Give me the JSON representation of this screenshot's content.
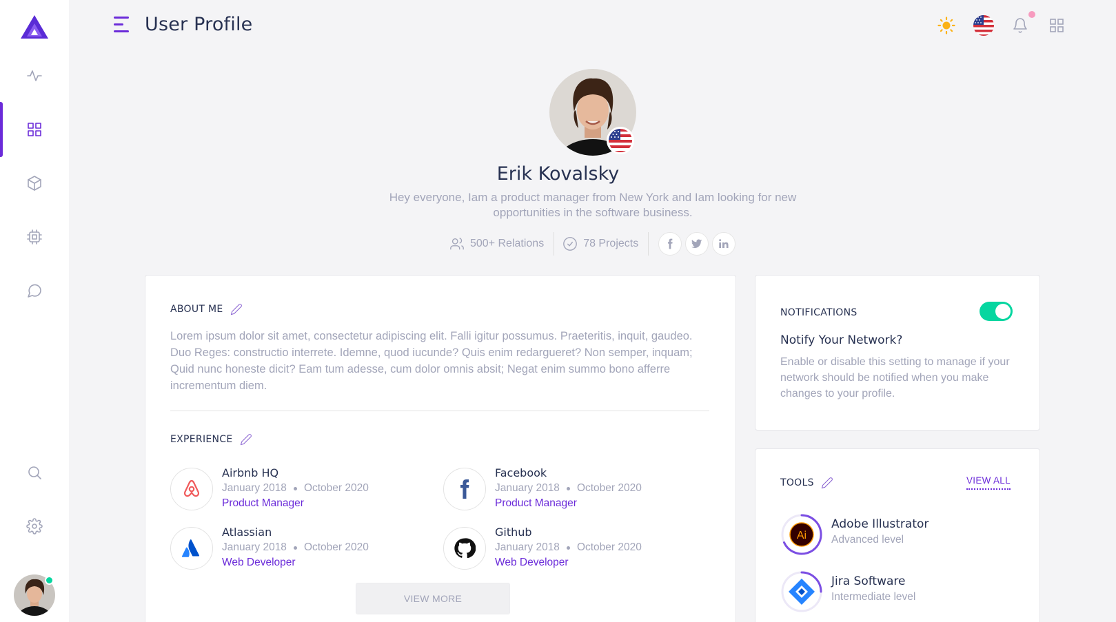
{
  "header": {
    "title": "User Profile"
  },
  "sidebar": {
    "items": [
      {
        "icon": "activity-icon"
      },
      {
        "icon": "grid-icon",
        "active": true
      },
      {
        "icon": "cube-icon"
      },
      {
        "icon": "cpu-icon"
      },
      {
        "icon": "message-icon"
      },
      {
        "icon": "search-icon"
      },
      {
        "icon": "settings-icon"
      }
    ]
  },
  "profile": {
    "name": "Erik Kovalsky",
    "bio": "Hey everyone, Iam a product manager from New York and Iam looking for new opportunities in the software business.",
    "relations": "500+ Relations",
    "projects": "78 Projects",
    "socials": [
      "facebook-icon",
      "twitter-icon",
      "linkedin-icon"
    ]
  },
  "about": {
    "title": "ABOUT ME",
    "text": "Lorem ipsum dolor sit amet, consectetur adipiscing elit. Falli igitur possumus. Praeteritis, inquit, gaudeo. Duo Reges: constructio interrete. Idemne, quod iucunde? Quis enim redargueret? Non semper, inquam; Quid nunc honeste dicit? Eam tum adesse, cum dolor omnis absit; Negat enim summo bono afferre incrementum diem."
  },
  "experience": {
    "title": "EXPERIENCE",
    "items": [
      {
        "company": "Airbnb HQ",
        "start": "January 2018",
        "end": "October 2020",
        "role": "Product Manager",
        "logo": "airbnb-icon"
      },
      {
        "company": "Facebook",
        "start": "January 2018",
        "end": "October 2020",
        "role": "Product Manager",
        "logo": "facebook-icon"
      },
      {
        "company": "Atlassian",
        "start": "January 2018",
        "end": "October 2020",
        "role": "Web Developer",
        "logo": "atlassian-icon"
      },
      {
        "company": "Github",
        "start": "January 2018",
        "end": "October 2020",
        "role": "Web Developer",
        "logo": "github-icon"
      }
    ],
    "view_more": "VIEW MORE"
  },
  "notifications": {
    "title": "NOTIFICATIONS",
    "enabled": true,
    "subtitle": "Notify Your Network?",
    "text": "Enable or disable this setting to manage if your network should be notified when you make changes to your profile."
  },
  "tools": {
    "title": "TOOLS",
    "view_all": "VIEW ALL",
    "items": [
      {
        "name": "Adobe Illustrator",
        "level": "Advanced level",
        "icon": "illustrator-icon"
      },
      {
        "name": "Jira Software",
        "level": "Intermediate level",
        "icon": "jira-icon"
      }
    ]
  },
  "colors": {
    "accent": "#6b2bd9",
    "success": "#06d6a0",
    "muted": "#a2a5b9",
    "heading": "#283252"
  }
}
